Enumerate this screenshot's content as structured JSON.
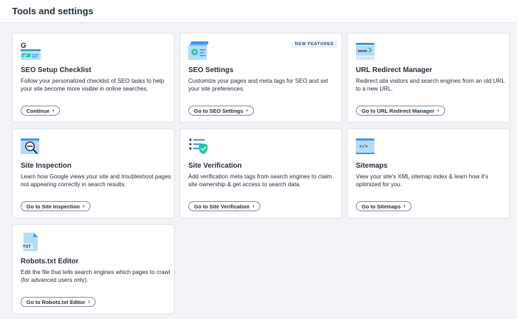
{
  "header": {
    "title": "Tools and settings"
  },
  "cards": [
    {
      "title": "SEO Setup Checklist",
      "description": "Follow your personalized checklist of SEO tasks to help your site become more visible in online searches.",
      "button": "Continue",
      "icon": "google-checklist-icon"
    },
    {
      "title": "SEO Settings",
      "description": "Customize your pages and meta tags for SEO and set your site preferences.",
      "button": "Go to SEO Settings",
      "badge": "NEW FEATURES",
      "icon": "settings-gear-icon"
    },
    {
      "title": "URL Redirect Manager",
      "description": "Redirect site visitors and search engines from an old URL to a new URL.",
      "button": "Go to URL Redirect Manager",
      "icon": "url-redirect-icon",
      "icon_text": "www"
    },
    {
      "title": "Site Inspection",
      "description": "Learn how Google views your site and troubleshoot pages not appearing correctly in search results.",
      "button": "Go to Site Inspection",
      "icon": "magnifier-icon"
    },
    {
      "title": "Site Verification",
      "description": "Add verification meta tags from search engines to claim site ownership & get access to search data.",
      "button": "Go to Site Verification",
      "icon": "verification-shield-icon"
    },
    {
      "title": "Sitemaps",
      "description": "View your site's XML sitemap index & learn how it's optimized for you.",
      "button": "Go to Sitemaps",
      "icon": "code-sitemap-icon",
      "icon_text": "</>"
    },
    {
      "title": "Robots.txt Editor",
      "description": "Edit the file that tells search engines which pages to crawl (for advanced users only).",
      "button": "Go to Robots.txt Editor",
      "icon": "txt-file-icon",
      "icon_text": "TXT"
    }
  ],
  "colors": {
    "accent_blue": "#3899ec",
    "light_blue": "#b4dcf8",
    "green": "#25c5a0",
    "background": "#f0f4f7"
  }
}
